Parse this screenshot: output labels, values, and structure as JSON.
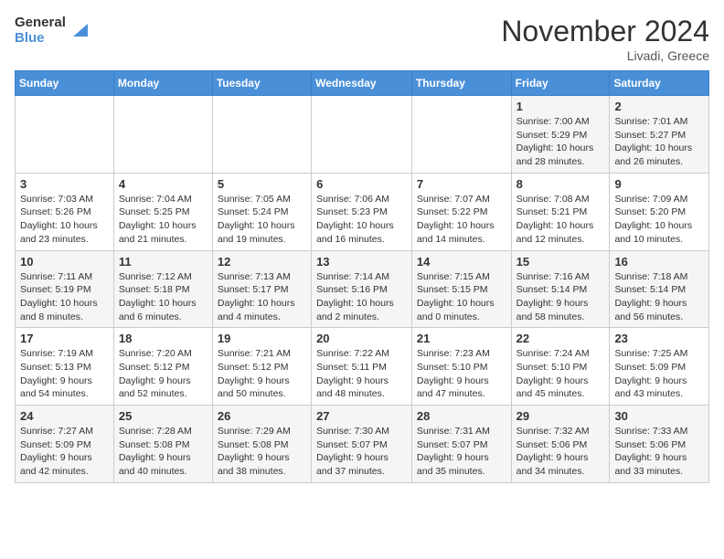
{
  "logo": {
    "text_general": "General",
    "text_blue": "Blue"
  },
  "title": "November 2024",
  "location": "Livadi, Greece",
  "days_of_week": [
    "Sunday",
    "Monday",
    "Tuesday",
    "Wednesday",
    "Thursday",
    "Friday",
    "Saturday"
  ],
  "weeks": [
    [
      {
        "num": "",
        "info": ""
      },
      {
        "num": "",
        "info": ""
      },
      {
        "num": "",
        "info": ""
      },
      {
        "num": "",
        "info": ""
      },
      {
        "num": "",
        "info": ""
      },
      {
        "num": "1",
        "info": "Sunrise: 7:00 AM\nSunset: 5:29 PM\nDaylight: 10 hours\nand 28 minutes."
      },
      {
        "num": "2",
        "info": "Sunrise: 7:01 AM\nSunset: 5:27 PM\nDaylight: 10 hours\nand 26 minutes."
      }
    ],
    [
      {
        "num": "3",
        "info": "Sunrise: 7:03 AM\nSunset: 5:26 PM\nDaylight: 10 hours\nand 23 minutes."
      },
      {
        "num": "4",
        "info": "Sunrise: 7:04 AM\nSunset: 5:25 PM\nDaylight: 10 hours\nand 21 minutes."
      },
      {
        "num": "5",
        "info": "Sunrise: 7:05 AM\nSunset: 5:24 PM\nDaylight: 10 hours\nand 19 minutes."
      },
      {
        "num": "6",
        "info": "Sunrise: 7:06 AM\nSunset: 5:23 PM\nDaylight: 10 hours\nand 16 minutes."
      },
      {
        "num": "7",
        "info": "Sunrise: 7:07 AM\nSunset: 5:22 PM\nDaylight: 10 hours\nand 14 minutes."
      },
      {
        "num": "8",
        "info": "Sunrise: 7:08 AM\nSunset: 5:21 PM\nDaylight: 10 hours\nand 12 minutes."
      },
      {
        "num": "9",
        "info": "Sunrise: 7:09 AM\nSunset: 5:20 PM\nDaylight: 10 hours\nand 10 minutes."
      }
    ],
    [
      {
        "num": "10",
        "info": "Sunrise: 7:11 AM\nSunset: 5:19 PM\nDaylight: 10 hours\nand 8 minutes."
      },
      {
        "num": "11",
        "info": "Sunrise: 7:12 AM\nSunset: 5:18 PM\nDaylight: 10 hours\nand 6 minutes."
      },
      {
        "num": "12",
        "info": "Sunrise: 7:13 AM\nSunset: 5:17 PM\nDaylight: 10 hours\nand 4 minutes."
      },
      {
        "num": "13",
        "info": "Sunrise: 7:14 AM\nSunset: 5:16 PM\nDaylight: 10 hours\nand 2 minutes."
      },
      {
        "num": "14",
        "info": "Sunrise: 7:15 AM\nSunset: 5:15 PM\nDaylight: 10 hours\nand 0 minutes."
      },
      {
        "num": "15",
        "info": "Sunrise: 7:16 AM\nSunset: 5:14 PM\nDaylight: 9 hours\nand 58 minutes."
      },
      {
        "num": "16",
        "info": "Sunrise: 7:18 AM\nSunset: 5:14 PM\nDaylight: 9 hours\nand 56 minutes."
      }
    ],
    [
      {
        "num": "17",
        "info": "Sunrise: 7:19 AM\nSunset: 5:13 PM\nDaylight: 9 hours\nand 54 minutes."
      },
      {
        "num": "18",
        "info": "Sunrise: 7:20 AM\nSunset: 5:12 PM\nDaylight: 9 hours\nand 52 minutes."
      },
      {
        "num": "19",
        "info": "Sunrise: 7:21 AM\nSunset: 5:12 PM\nDaylight: 9 hours\nand 50 minutes."
      },
      {
        "num": "20",
        "info": "Sunrise: 7:22 AM\nSunset: 5:11 PM\nDaylight: 9 hours\nand 48 minutes."
      },
      {
        "num": "21",
        "info": "Sunrise: 7:23 AM\nSunset: 5:10 PM\nDaylight: 9 hours\nand 47 minutes."
      },
      {
        "num": "22",
        "info": "Sunrise: 7:24 AM\nSunset: 5:10 PM\nDaylight: 9 hours\nand 45 minutes."
      },
      {
        "num": "23",
        "info": "Sunrise: 7:25 AM\nSunset: 5:09 PM\nDaylight: 9 hours\nand 43 minutes."
      }
    ],
    [
      {
        "num": "24",
        "info": "Sunrise: 7:27 AM\nSunset: 5:09 PM\nDaylight: 9 hours\nand 42 minutes."
      },
      {
        "num": "25",
        "info": "Sunrise: 7:28 AM\nSunset: 5:08 PM\nDaylight: 9 hours\nand 40 minutes."
      },
      {
        "num": "26",
        "info": "Sunrise: 7:29 AM\nSunset: 5:08 PM\nDaylight: 9 hours\nand 38 minutes."
      },
      {
        "num": "27",
        "info": "Sunrise: 7:30 AM\nSunset: 5:07 PM\nDaylight: 9 hours\nand 37 minutes."
      },
      {
        "num": "28",
        "info": "Sunrise: 7:31 AM\nSunset: 5:07 PM\nDaylight: 9 hours\nand 35 minutes."
      },
      {
        "num": "29",
        "info": "Sunrise: 7:32 AM\nSunset: 5:06 PM\nDaylight: 9 hours\nand 34 minutes."
      },
      {
        "num": "30",
        "info": "Sunrise: 7:33 AM\nSunset: 5:06 PM\nDaylight: 9 hours\nand 33 minutes."
      }
    ]
  ]
}
